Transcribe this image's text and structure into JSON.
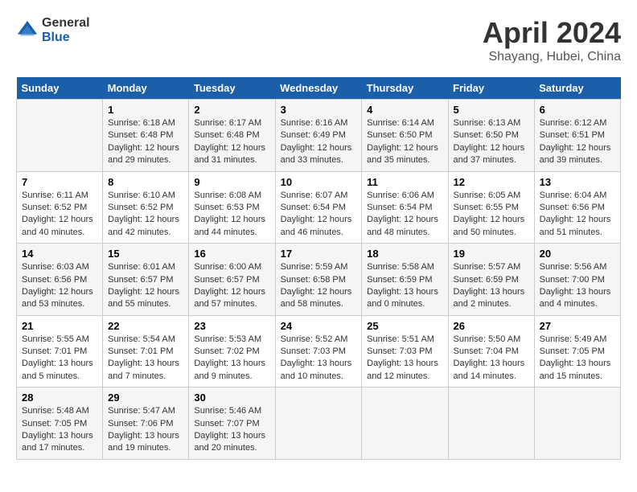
{
  "header": {
    "logo_general": "General",
    "logo_blue": "Blue",
    "main_title": "April 2024",
    "subtitle": "Shayang, Hubei, China"
  },
  "calendar": {
    "days_of_week": [
      "Sunday",
      "Monday",
      "Tuesday",
      "Wednesday",
      "Thursday",
      "Friday",
      "Saturday"
    ],
    "weeks": [
      [
        {
          "day": "",
          "info": ""
        },
        {
          "day": "1",
          "info": "Sunrise: 6:18 AM\nSunset: 6:48 PM\nDaylight: 12 hours\nand 29 minutes."
        },
        {
          "day": "2",
          "info": "Sunrise: 6:17 AM\nSunset: 6:48 PM\nDaylight: 12 hours\nand 31 minutes."
        },
        {
          "day": "3",
          "info": "Sunrise: 6:16 AM\nSunset: 6:49 PM\nDaylight: 12 hours\nand 33 minutes."
        },
        {
          "day": "4",
          "info": "Sunrise: 6:14 AM\nSunset: 6:50 PM\nDaylight: 12 hours\nand 35 minutes."
        },
        {
          "day": "5",
          "info": "Sunrise: 6:13 AM\nSunset: 6:50 PM\nDaylight: 12 hours\nand 37 minutes."
        },
        {
          "day": "6",
          "info": "Sunrise: 6:12 AM\nSunset: 6:51 PM\nDaylight: 12 hours\nand 39 minutes."
        }
      ],
      [
        {
          "day": "7",
          "info": "Sunrise: 6:11 AM\nSunset: 6:52 PM\nDaylight: 12 hours\nand 40 minutes."
        },
        {
          "day": "8",
          "info": "Sunrise: 6:10 AM\nSunset: 6:52 PM\nDaylight: 12 hours\nand 42 minutes."
        },
        {
          "day": "9",
          "info": "Sunrise: 6:08 AM\nSunset: 6:53 PM\nDaylight: 12 hours\nand 44 minutes."
        },
        {
          "day": "10",
          "info": "Sunrise: 6:07 AM\nSunset: 6:54 PM\nDaylight: 12 hours\nand 46 minutes."
        },
        {
          "day": "11",
          "info": "Sunrise: 6:06 AM\nSunset: 6:54 PM\nDaylight: 12 hours\nand 48 minutes."
        },
        {
          "day": "12",
          "info": "Sunrise: 6:05 AM\nSunset: 6:55 PM\nDaylight: 12 hours\nand 50 minutes."
        },
        {
          "day": "13",
          "info": "Sunrise: 6:04 AM\nSunset: 6:56 PM\nDaylight: 12 hours\nand 51 minutes."
        }
      ],
      [
        {
          "day": "14",
          "info": "Sunrise: 6:03 AM\nSunset: 6:56 PM\nDaylight: 12 hours\nand 53 minutes."
        },
        {
          "day": "15",
          "info": "Sunrise: 6:01 AM\nSunset: 6:57 PM\nDaylight: 12 hours\nand 55 minutes."
        },
        {
          "day": "16",
          "info": "Sunrise: 6:00 AM\nSunset: 6:57 PM\nDaylight: 12 hours\nand 57 minutes."
        },
        {
          "day": "17",
          "info": "Sunrise: 5:59 AM\nSunset: 6:58 PM\nDaylight: 12 hours\nand 58 minutes."
        },
        {
          "day": "18",
          "info": "Sunrise: 5:58 AM\nSunset: 6:59 PM\nDaylight: 13 hours\nand 0 minutes."
        },
        {
          "day": "19",
          "info": "Sunrise: 5:57 AM\nSunset: 6:59 PM\nDaylight: 13 hours\nand 2 minutes."
        },
        {
          "day": "20",
          "info": "Sunrise: 5:56 AM\nSunset: 7:00 PM\nDaylight: 13 hours\nand 4 minutes."
        }
      ],
      [
        {
          "day": "21",
          "info": "Sunrise: 5:55 AM\nSunset: 7:01 PM\nDaylight: 13 hours\nand 5 minutes."
        },
        {
          "day": "22",
          "info": "Sunrise: 5:54 AM\nSunset: 7:01 PM\nDaylight: 13 hours\nand 7 minutes."
        },
        {
          "day": "23",
          "info": "Sunrise: 5:53 AM\nSunset: 7:02 PM\nDaylight: 13 hours\nand 9 minutes."
        },
        {
          "day": "24",
          "info": "Sunrise: 5:52 AM\nSunset: 7:03 PM\nDaylight: 13 hours\nand 10 minutes."
        },
        {
          "day": "25",
          "info": "Sunrise: 5:51 AM\nSunset: 7:03 PM\nDaylight: 13 hours\nand 12 minutes."
        },
        {
          "day": "26",
          "info": "Sunrise: 5:50 AM\nSunset: 7:04 PM\nDaylight: 13 hours\nand 14 minutes."
        },
        {
          "day": "27",
          "info": "Sunrise: 5:49 AM\nSunset: 7:05 PM\nDaylight: 13 hours\nand 15 minutes."
        }
      ],
      [
        {
          "day": "28",
          "info": "Sunrise: 5:48 AM\nSunset: 7:05 PM\nDaylight: 13 hours\nand 17 minutes."
        },
        {
          "day": "29",
          "info": "Sunrise: 5:47 AM\nSunset: 7:06 PM\nDaylight: 13 hours\nand 19 minutes."
        },
        {
          "day": "30",
          "info": "Sunrise: 5:46 AM\nSunset: 7:07 PM\nDaylight: 13 hours\nand 20 minutes."
        },
        {
          "day": "",
          "info": ""
        },
        {
          "day": "",
          "info": ""
        },
        {
          "day": "",
          "info": ""
        },
        {
          "day": "",
          "info": ""
        }
      ]
    ]
  }
}
